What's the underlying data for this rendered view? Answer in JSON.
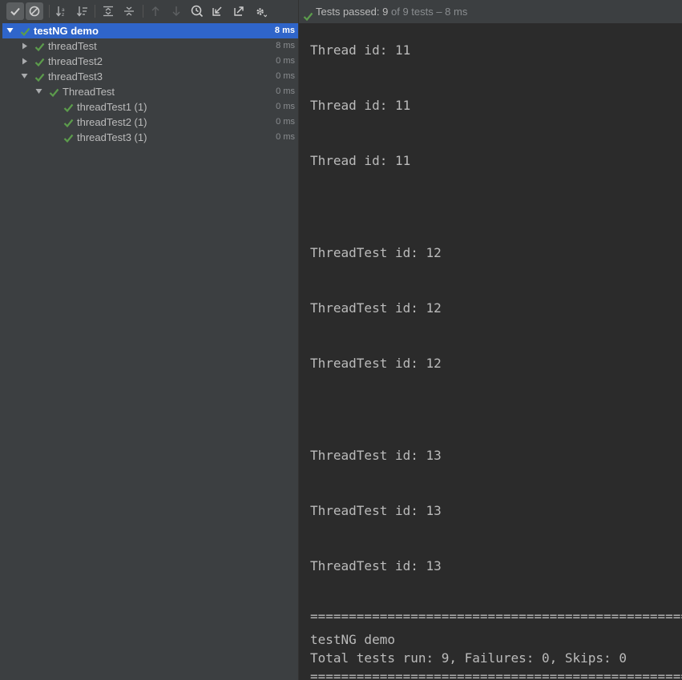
{
  "toolbar": {
    "buttons": [
      {
        "name": "show-passed-icon",
        "active": true
      },
      {
        "name": "show-ignored-icon",
        "active": true
      },
      {
        "name": "sort-alphabetically-icon",
        "active": false
      },
      {
        "name": "sort-by-duration-icon",
        "active": false
      },
      {
        "name": "expand-all-icon",
        "active": false
      },
      {
        "name": "collapse-all-icon",
        "active": false
      },
      {
        "name": "previous-failed-icon",
        "active": false
      },
      {
        "name": "next-failed-icon",
        "active": false
      },
      {
        "name": "test-history-icon",
        "active": false
      },
      {
        "name": "import-tests-icon",
        "active": false
      },
      {
        "name": "export-tests-icon",
        "active": false
      },
      {
        "name": "settings-gear-icon",
        "active": false
      }
    ]
  },
  "tree": [
    {
      "label": "testNG demo",
      "duration": "8 ms",
      "depth": 0,
      "arrow": "down",
      "selected": true
    },
    {
      "label": "threadTest",
      "duration": "8 ms",
      "depth": 1,
      "arrow": "right",
      "selected": false
    },
    {
      "label": "threadTest2",
      "duration": "0 ms",
      "depth": 1,
      "arrow": "right",
      "selected": false
    },
    {
      "label": "threadTest3",
      "duration": "0 ms",
      "depth": 1,
      "arrow": "down",
      "selected": false
    },
    {
      "label": "ThreadTest",
      "duration": "0 ms",
      "depth": 2,
      "arrow": "down",
      "selected": false
    },
    {
      "label": "threadTest1 (1)",
      "duration": "0 ms",
      "depth": 3,
      "arrow": "none",
      "selected": false
    },
    {
      "label": "threadTest2 (1)",
      "duration": "0 ms",
      "depth": 3,
      "arrow": "none",
      "selected": false
    },
    {
      "label": "threadTest3 (1)",
      "duration": "0 ms",
      "depth": 3,
      "arrow": "none",
      "selected": false
    }
  ],
  "status": {
    "prefix": "Tests passed:",
    "passed": "9",
    "suffix": "of 9 tests – 8 ms"
  },
  "console": {
    "lines": [
      {
        "text": "Thread id: 11"
      },
      {
        "text": "Thread id: 11"
      },
      {
        "text": "Thread id: 11"
      },
      {
        "text": "ThreadTest id: 12"
      },
      {
        "text": "ThreadTest id: 12"
      },
      {
        "text": "ThreadTest id: 12"
      },
      {
        "text": "ThreadTest id: 13"
      },
      {
        "text": "ThreadTest id: 13"
      },
      {
        "text": "ThreadTest id: 13"
      },
      {
        "text": "==================================================="
      },
      {
        "text": "testNG demo"
      },
      {
        "text": "Total tests run: 9, Failures: 0, Skips: 0"
      },
      {
        "text": "==================================================="
      }
    ]
  },
  "colors": {
    "pass_green": "#5c9c4c",
    "selection_blue": "#2f65ca"
  }
}
